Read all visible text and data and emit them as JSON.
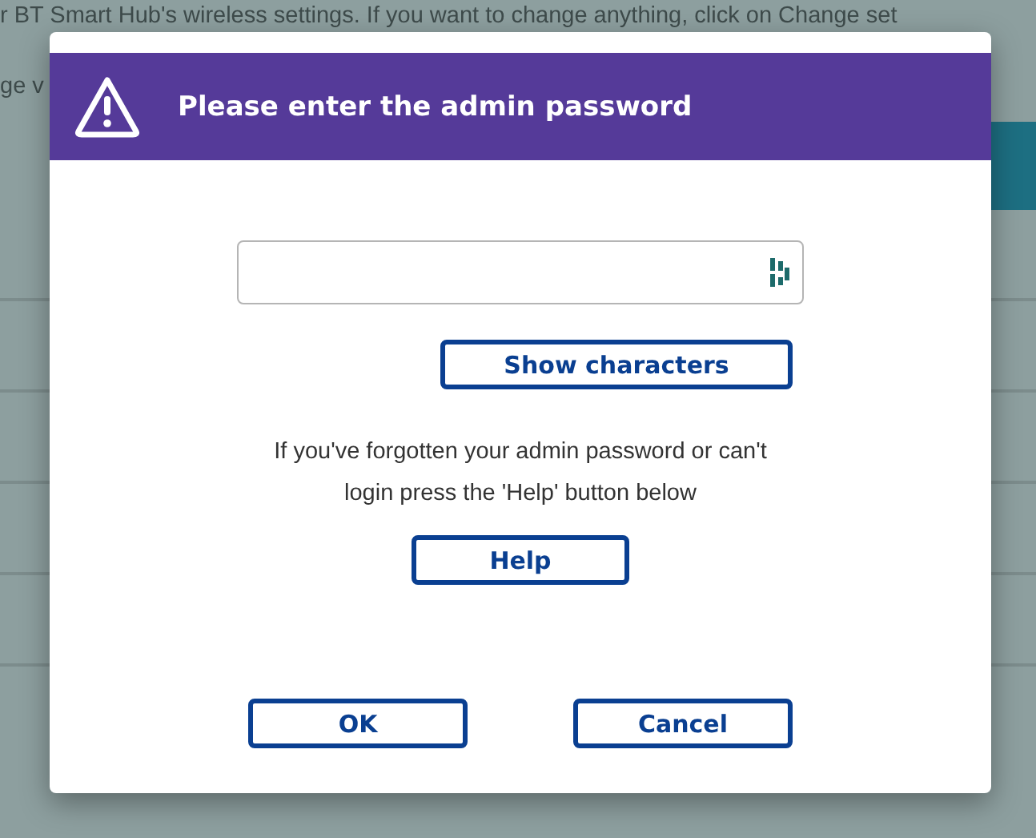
{
  "background": {
    "lines": [
      "r BT Smart Hub's wireless settings. If you want to change anything, click on Change set",
      "ge v"
    ]
  },
  "dialog": {
    "title": "Please enter the admin password",
    "show_button": "Show characters",
    "help_text": "If you've forgotten your admin password or can't login press the 'Help' button below",
    "help_button": "Help",
    "buttons": [
      "OK",
      "Cancel"
    ]
  }
}
